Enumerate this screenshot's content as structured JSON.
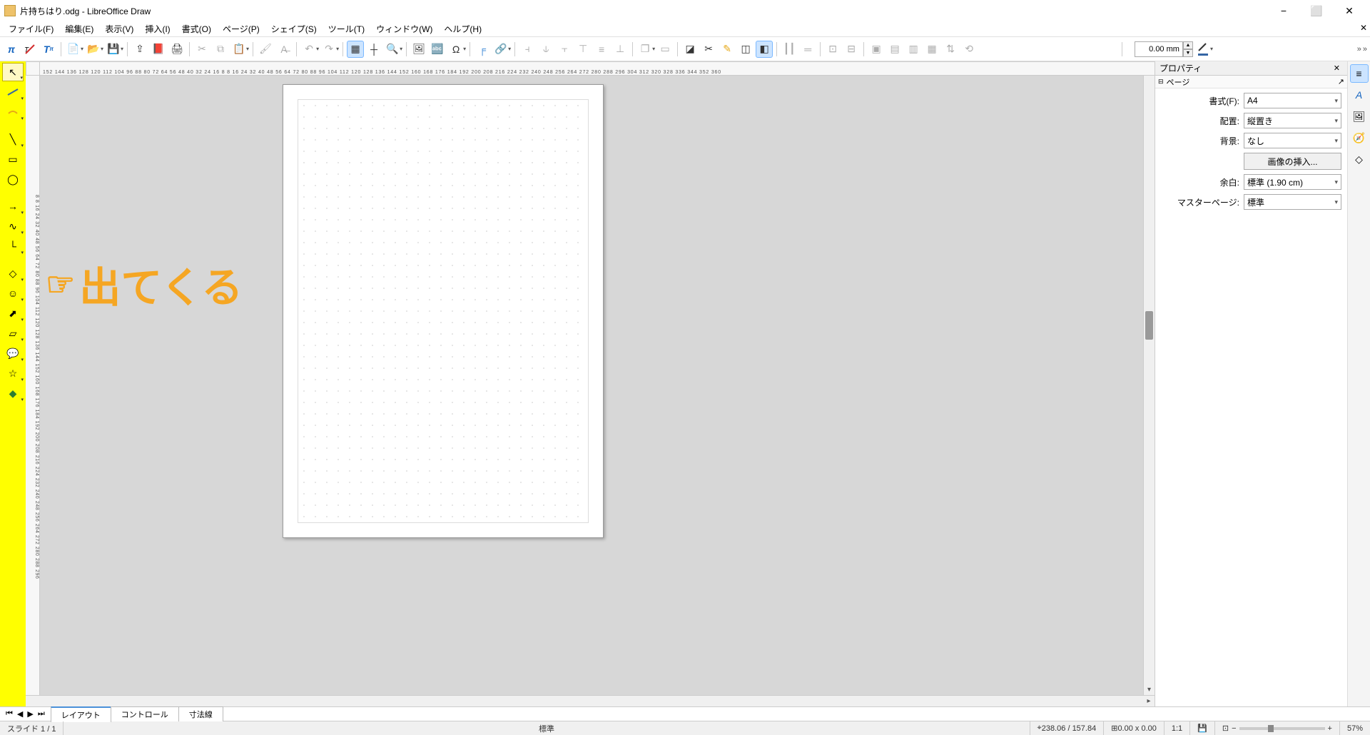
{
  "title": "片持ちはり.odg - LibreOffice Draw",
  "window_controls": {
    "min": "−",
    "max": "⬜",
    "close": "✕"
  },
  "menu": {
    "file": "ファイル(F)",
    "edit": "編集(E)",
    "view": "表示(V)",
    "insert": "挿入(I)",
    "format": "書式(O)",
    "page": "ページ(P)",
    "shape": "シェイプ(S)",
    "tools": "ツール(T)",
    "window": "ウィンドウ(W)",
    "help": "ヘルプ(H)"
  },
  "toolbar": {
    "line_width_value": "0.00 mm",
    "overflow": "»"
  },
  "ruler_h": "152 144 136 128 120 112 104 96  88  80  72  64  56  48  40  32  24  16   8        8  16  24  32  40  48  56  64  72  80  88  96 104 112 120 128 136 144 152 160 168 176 184 192 200 208 216 224 232 240 248 256 264 272 280 288 296 304 312 320 328 336 344 352 360",
  "ruler_v": "8 8 16 24 32 40 48 56 64 72 80 88 96 104 112 120 128 136 144 152 160 168 176 184 192 200 208 216 224 232 240 248 256 264 272 280 288 296",
  "overlay_text": "出てくる",
  "sidebar": {
    "title": "プロパティ",
    "section": "ページ",
    "format_label": "書式(F):",
    "format_value": "A4",
    "orient_label": "配置:",
    "orient_value": "縦置き",
    "bg_label": "背景:",
    "bg_value": "なし",
    "insert_image": "画像の挿入...",
    "margin_label": "余白:",
    "margin_value": "標準 (1.90 cm)",
    "master_label": "マスターページ:",
    "master_value": "標準"
  },
  "layers": {
    "layout": "レイアウト",
    "control": "コントロール",
    "dimlines": "寸法線"
  },
  "status": {
    "slide": "スライド 1 / 1",
    "std": "標準",
    "pos": "238.06 / 157.84",
    "size": "0.00 x 0.00",
    "scale": "1:1",
    "zoom": "57%"
  }
}
